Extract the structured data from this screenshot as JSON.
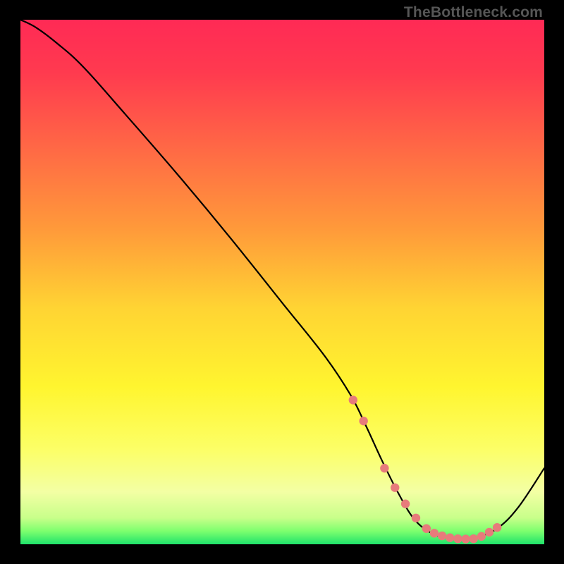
{
  "watermark": "TheBottleneck.com",
  "chart_data": {
    "type": "line",
    "title": "",
    "xlabel": "",
    "ylabel": "",
    "xlim": [
      0,
      100
    ],
    "ylim": [
      0,
      100
    ],
    "grid": false,
    "legend": false,
    "gradient_stops": [
      {
        "pos": 0.0,
        "color": "#ff2a55"
      },
      {
        "pos": 0.1,
        "color": "#ff3a4f"
      },
      {
        "pos": 0.25,
        "color": "#ff6a45"
      },
      {
        "pos": 0.4,
        "color": "#ff9a3a"
      },
      {
        "pos": 0.55,
        "color": "#ffd433"
      },
      {
        "pos": 0.7,
        "color": "#fff52f"
      },
      {
        "pos": 0.82,
        "color": "#fcff67"
      },
      {
        "pos": 0.9,
        "color": "#f3ffa4"
      },
      {
        "pos": 0.95,
        "color": "#c8ff8a"
      },
      {
        "pos": 0.975,
        "color": "#7dff6e"
      },
      {
        "pos": 1.0,
        "color": "#20e36b"
      }
    ],
    "series": [
      {
        "name": "bottleneck-curve",
        "stroke": "#000000",
        "stroke_width": 2.2,
        "x": [
          0.0,
          3.0,
          7.0,
          12.0,
          20.0,
          30.0,
          40.0,
          50.0,
          58.0,
          63.0,
          66.0,
          69.0,
          72.0,
          75.0,
          78.0,
          81.0,
          84.0,
          87.0,
          91.0,
          95.0,
          100.0
        ],
        "values": [
          100.0,
          98.5,
          95.5,
          91.0,
          82.0,
          70.5,
          58.5,
          46.0,
          36.0,
          28.5,
          22.5,
          16.0,
          10.0,
          5.0,
          2.4,
          1.3,
          1.0,
          1.3,
          3.0,
          7.0,
          14.5
        ]
      },
      {
        "name": "highlight-dots",
        "stroke": "#e77b7b",
        "marker": "dot",
        "marker_radius": 6.2,
        "x": [
          63.5,
          65.5,
          69.5,
          71.5,
          73.5,
          75.5,
          77.5,
          79.0,
          80.5,
          82.0,
          83.5,
          85.0,
          86.5,
          88.0,
          89.5,
          91.0
        ],
        "values": [
          27.5,
          23.5,
          14.5,
          10.8,
          7.7,
          5.0,
          3.0,
          2.1,
          1.6,
          1.25,
          1.05,
          1.0,
          1.05,
          1.5,
          2.3,
          3.2
        ]
      }
    ]
  }
}
